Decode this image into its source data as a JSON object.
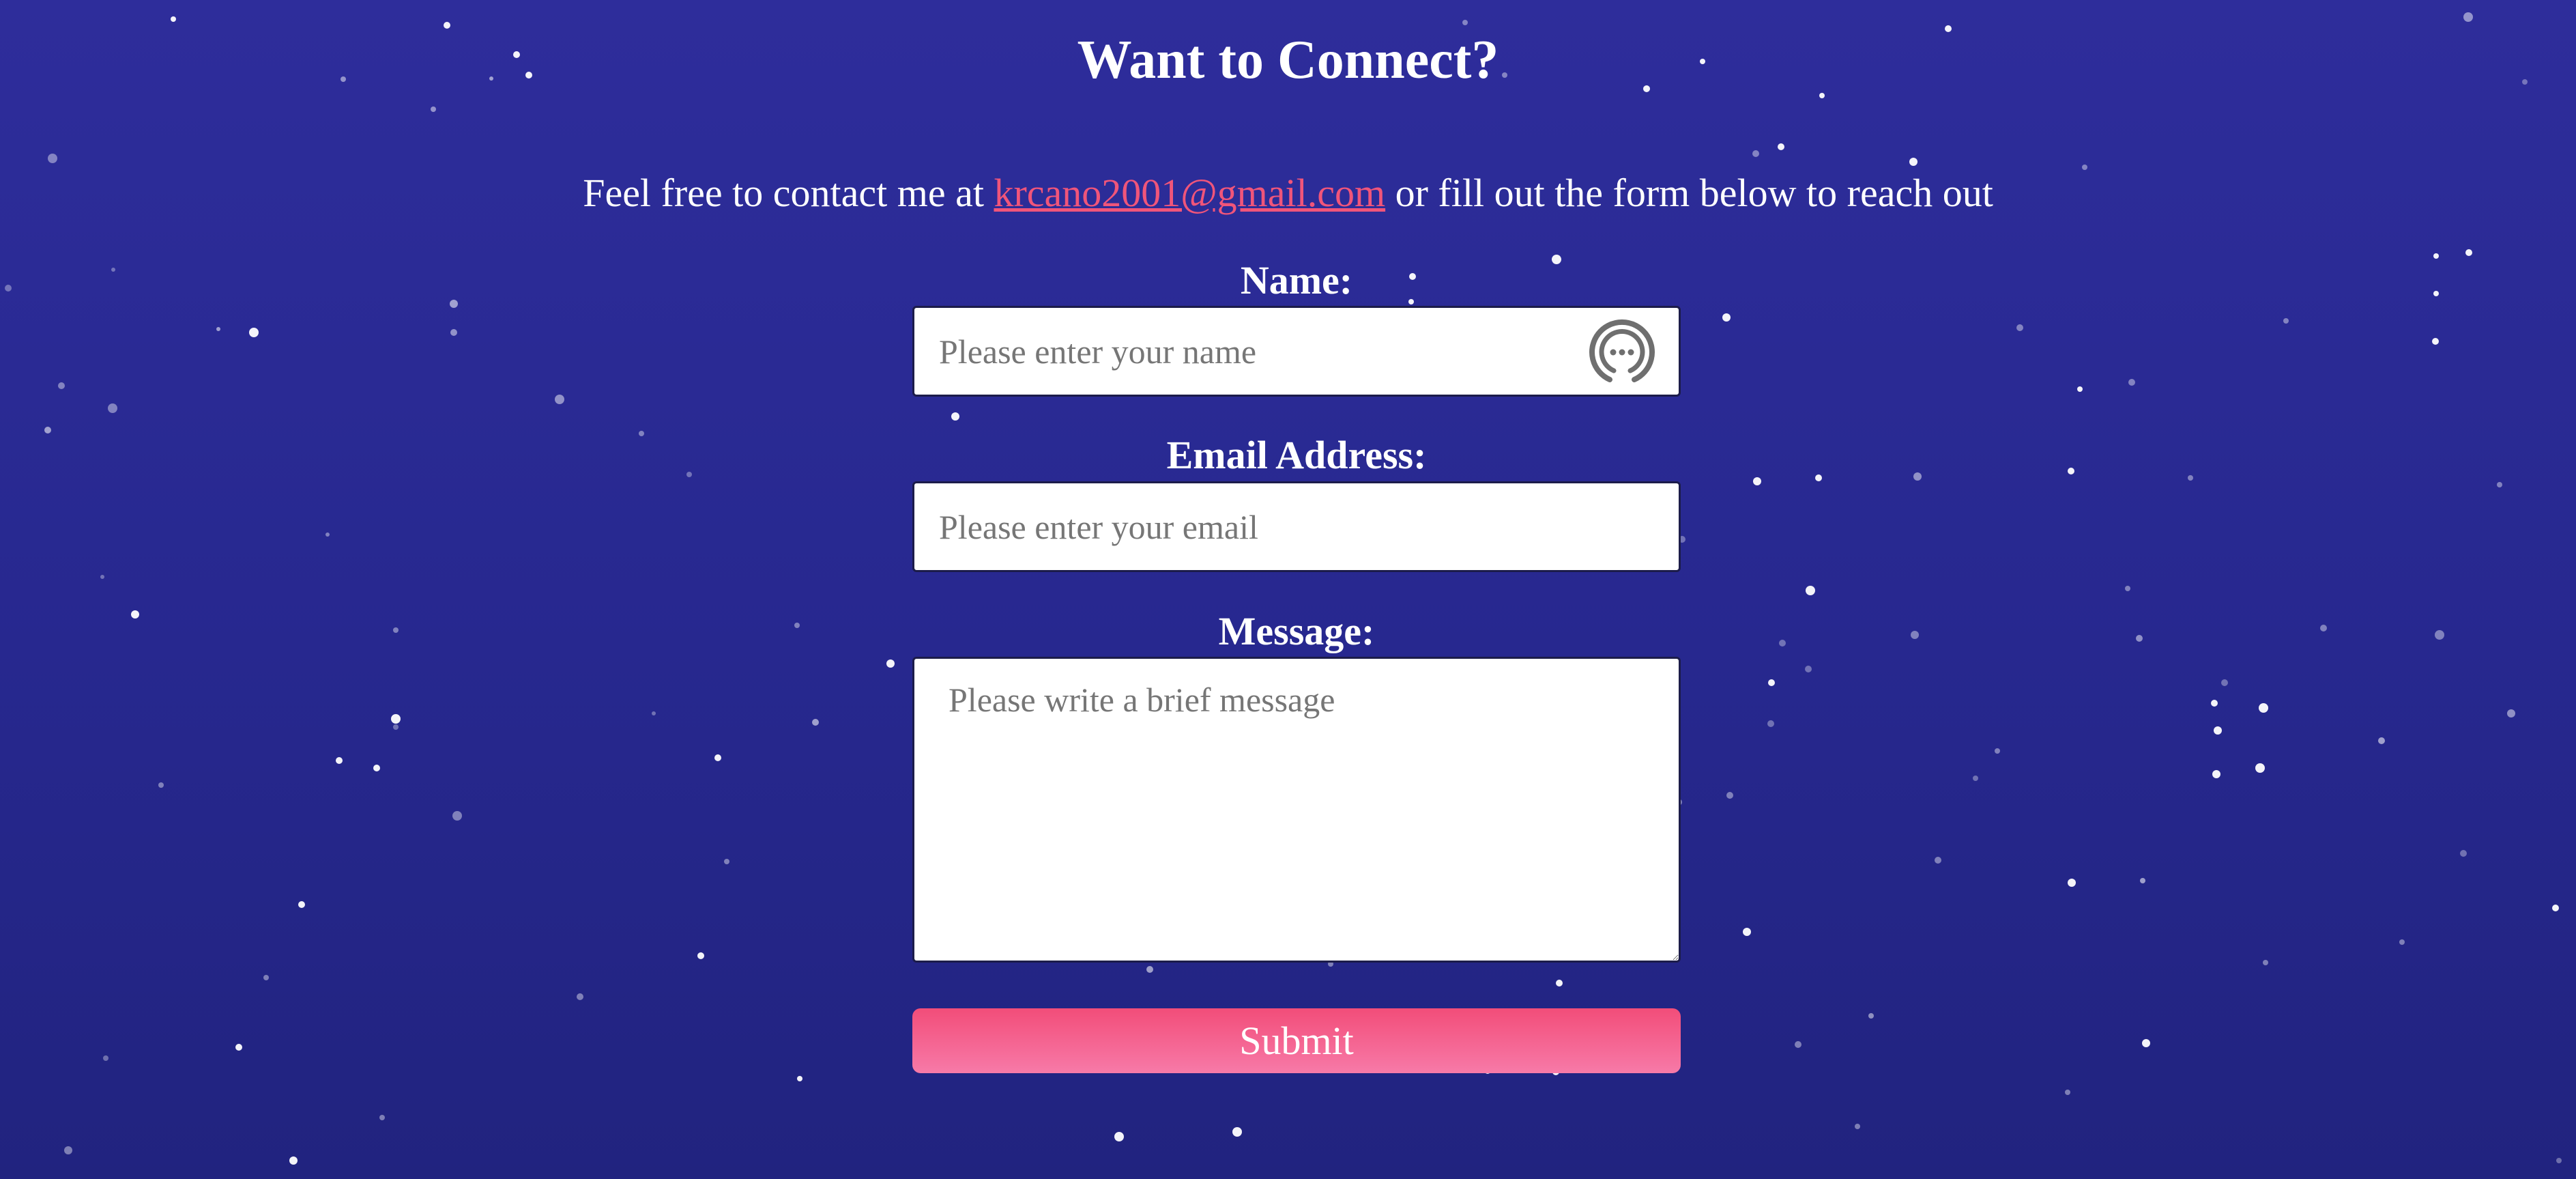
{
  "page": {
    "title": "Want to Connect?",
    "intro_before": "Feel free to contact me at ",
    "email_link": "krcano2001@gmail.com",
    "intro_after": " or fill out the form below to reach out"
  },
  "form": {
    "name_label": "Name:",
    "name_placeholder": "Please enter your name",
    "email_label": "Email Address:",
    "email_placeholder": "Please enter your email",
    "message_label": "Message:",
    "message_placeholder": "Please write a brief message",
    "submit_label": "Submit"
  },
  "icons": {
    "name_field_icon": "password-manager-icon"
  },
  "colors": {
    "background_top": "#2e2d9b",
    "background_bottom": "#21237f",
    "link": "#f0557a",
    "button_top": "#f24d79",
    "button_bottom": "#f77aa8"
  }
}
